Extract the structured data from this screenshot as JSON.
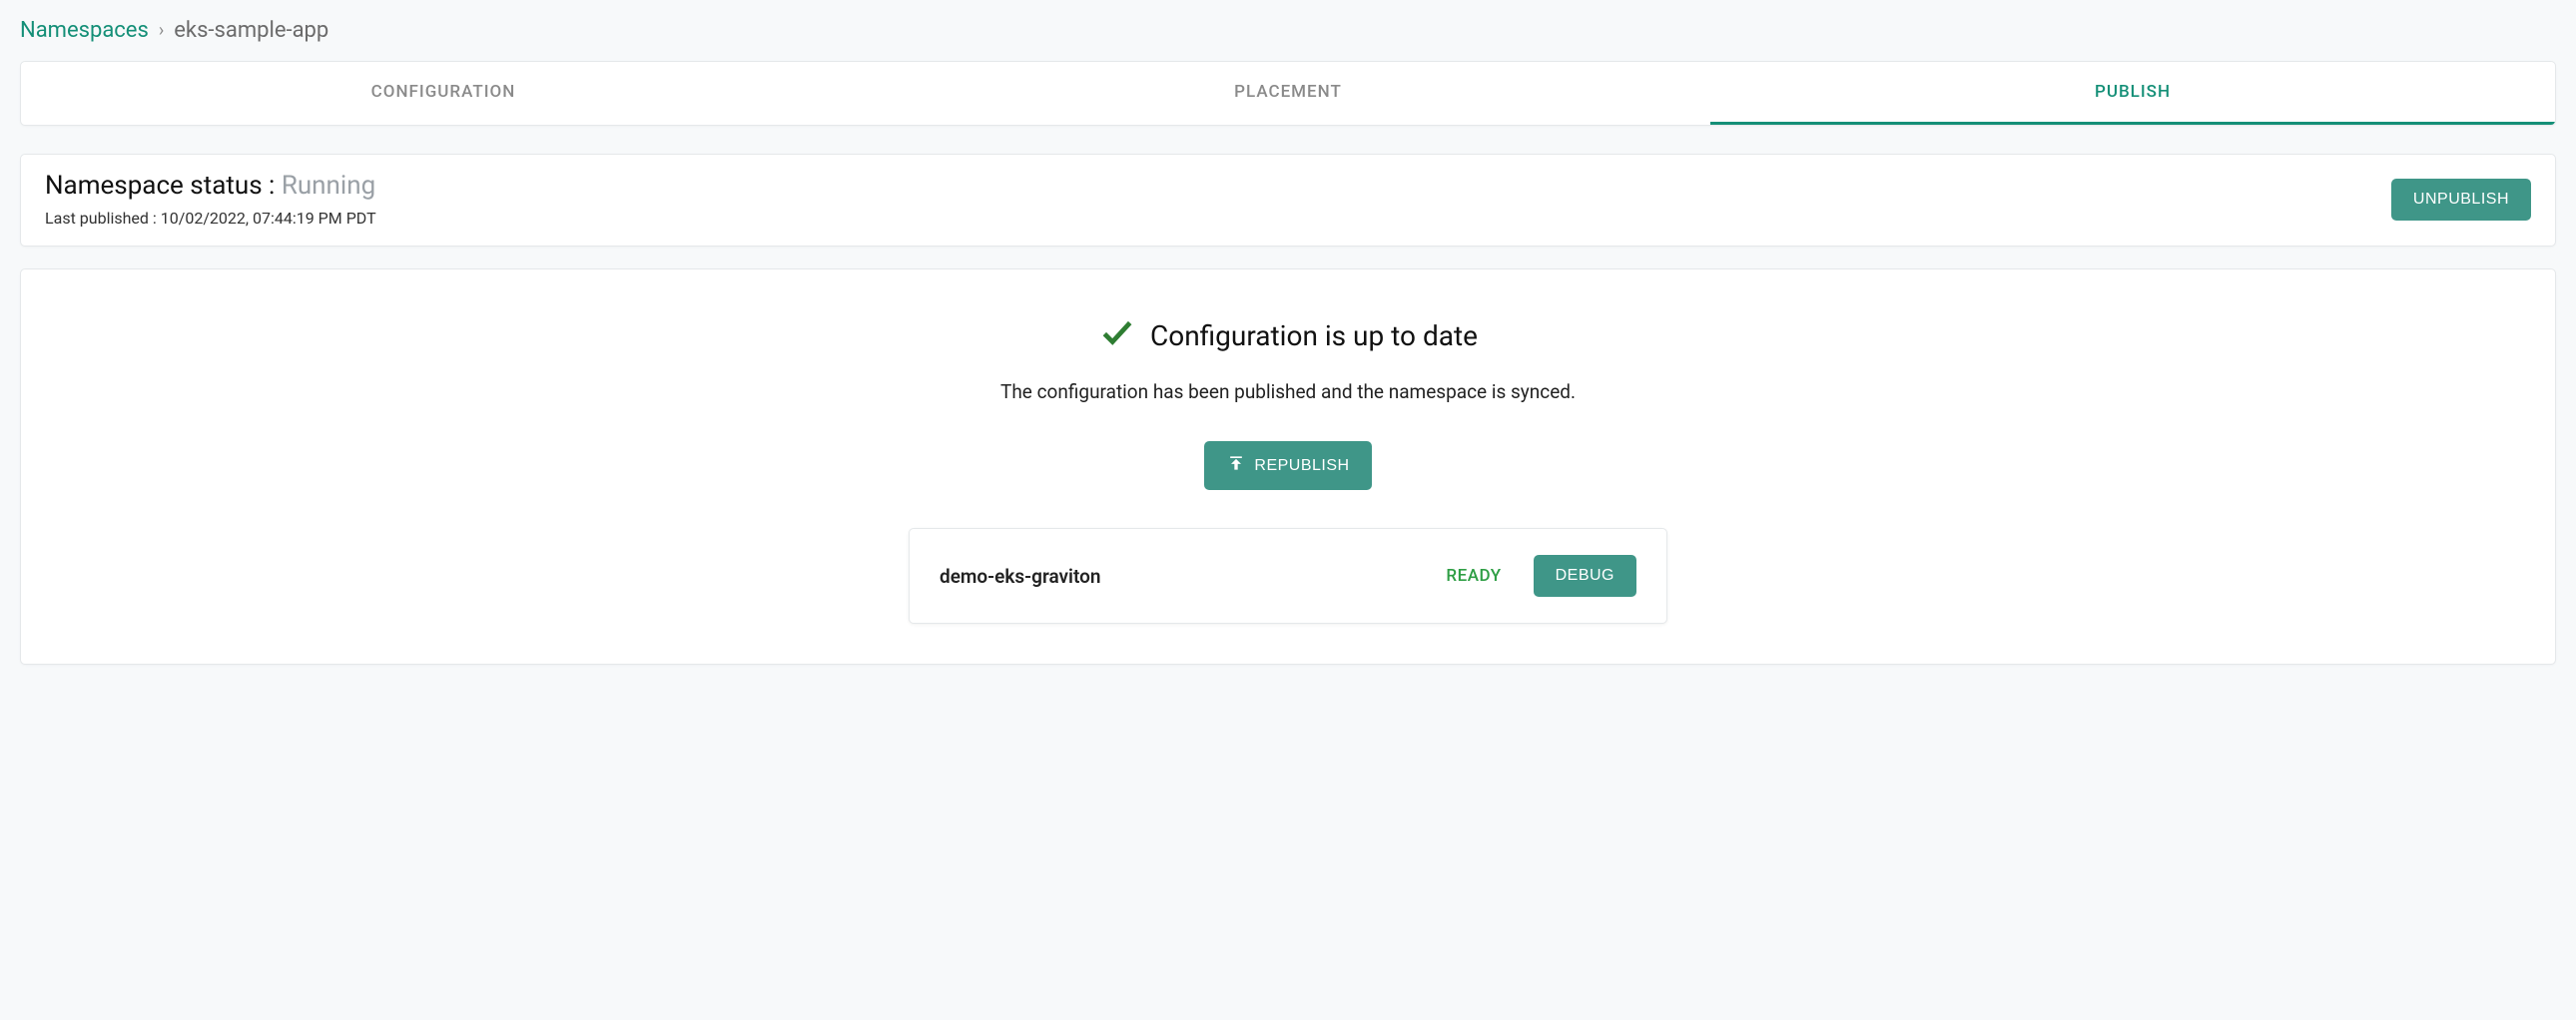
{
  "breadcrumb": {
    "root": "Namespaces",
    "separator": "›",
    "current": "eks-sample-app"
  },
  "tabs": {
    "configuration": "CONFIGURATION",
    "placement": "PLACEMENT",
    "publish": "PUBLISH"
  },
  "status": {
    "label": "Namespace status : ",
    "value": "Running",
    "last_published_label": "Last published : ",
    "last_published_value": "10/02/2022, 07:44:19 PM PDT",
    "unpublish_button": "UNPUBLISH"
  },
  "config": {
    "headline": "Configuration is up to date",
    "subtext": "The configuration has been published and the namespace is synced.",
    "republish_button": "REPUBLISH"
  },
  "cluster": {
    "name": "demo-eks-graviton",
    "status": "READY",
    "debug_button": "DEBUG"
  }
}
